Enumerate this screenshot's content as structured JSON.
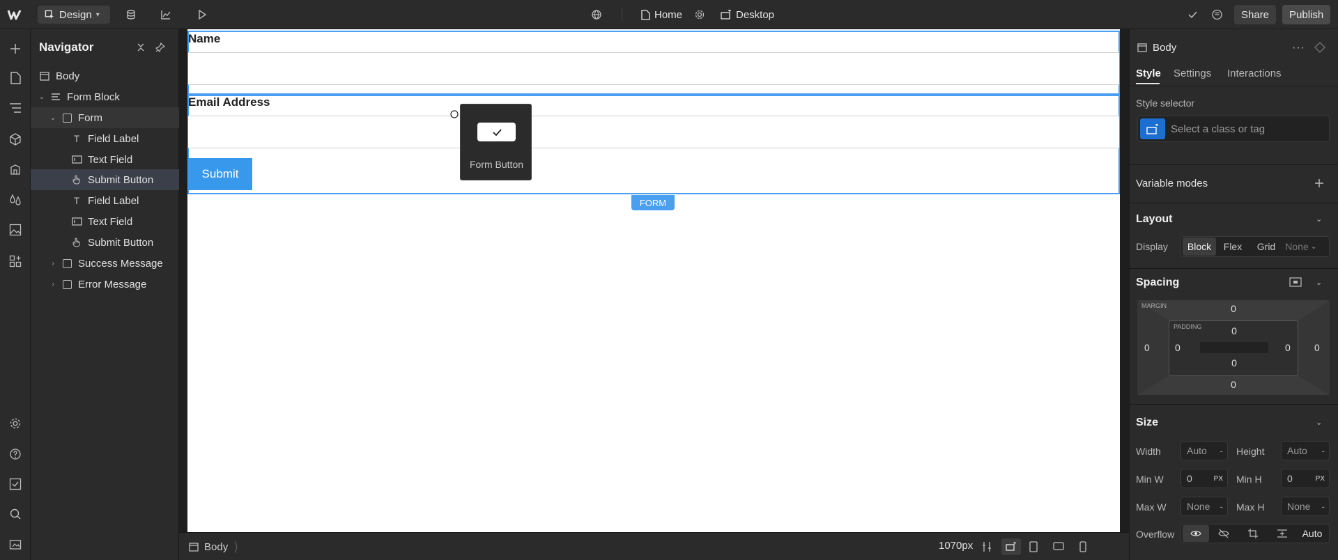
{
  "topbar": {
    "mode_label": "Design",
    "page_name": "Home",
    "breakpoint_label": "Desktop",
    "share_label": "Share",
    "publish_label": "Publish"
  },
  "navigator": {
    "title": "Navigator",
    "items": [
      {
        "label": "Body"
      },
      {
        "label": "Form Block"
      },
      {
        "label": "Form"
      },
      {
        "label": "Field Label"
      },
      {
        "label": "Text Field"
      },
      {
        "label": "Submit Button"
      },
      {
        "label": "Field Label"
      },
      {
        "label": "Text Field"
      },
      {
        "label": "Submit Button"
      },
      {
        "label": "Success Message"
      },
      {
        "label": "Error Message"
      }
    ]
  },
  "canvas": {
    "name_label": "Name",
    "email_label": "Email Address",
    "submit_label": "Submit",
    "form_tag": "FORM",
    "drag_preview_label": "Form Button"
  },
  "bottombar": {
    "breadcrumb": "Body",
    "width_readout": "1070px"
  },
  "panel": {
    "element_name": "Body",
    "tabs": [
      "Style",
      "Settings",
      "Interactions"
    ],
    "style_selector_label": "Style selector",
    "selector_placeholder": "Select a class or tag",
    "variable_modes_label": "Variable modes",
    "layout_heading": "Layout",
    "display_label": "Display",
    "display_options": [
      "Block",
      "Flex",
      "Grid",
      "None"
    ],
    "spacing_heading": "Spacing",
    "margin_label": "MARGIN",
    "padding_label": "PADDING",
    "margin": {
      "top": "0",
      "right": "0",
      "bottom": "0",
      "left": "0"
    },
    "padding": {
      "top": "0",
      "right": "0",
      "bottom": "0",
      "left": "0"
    },
    "size_heading": "Size",
    "width_label": "Width",
    "width_value": "Auto",
    "height_label": "Height",
    "height_value": "Auto",
    "minw_label": "Min W",
    "minw_value": "0",
    "minh_label": "Min H",
    "minh_value": "0",
    "maxw_label": "Max W",
    "maxw_value": "None",
    "maxh_label": "Max H",
    "maxh_value": "None",
    "unit_px": "PX",
    "dash": "-",
    "overflow_label": "Overflow",
    "overflow_auto": "Auto"
  },
  "colors": {
    "accent_blue": "#4a9ff0",
    "selected_row": "#3b3f4a",
    "publish_bg": "#4a4a4a"
  }
}
